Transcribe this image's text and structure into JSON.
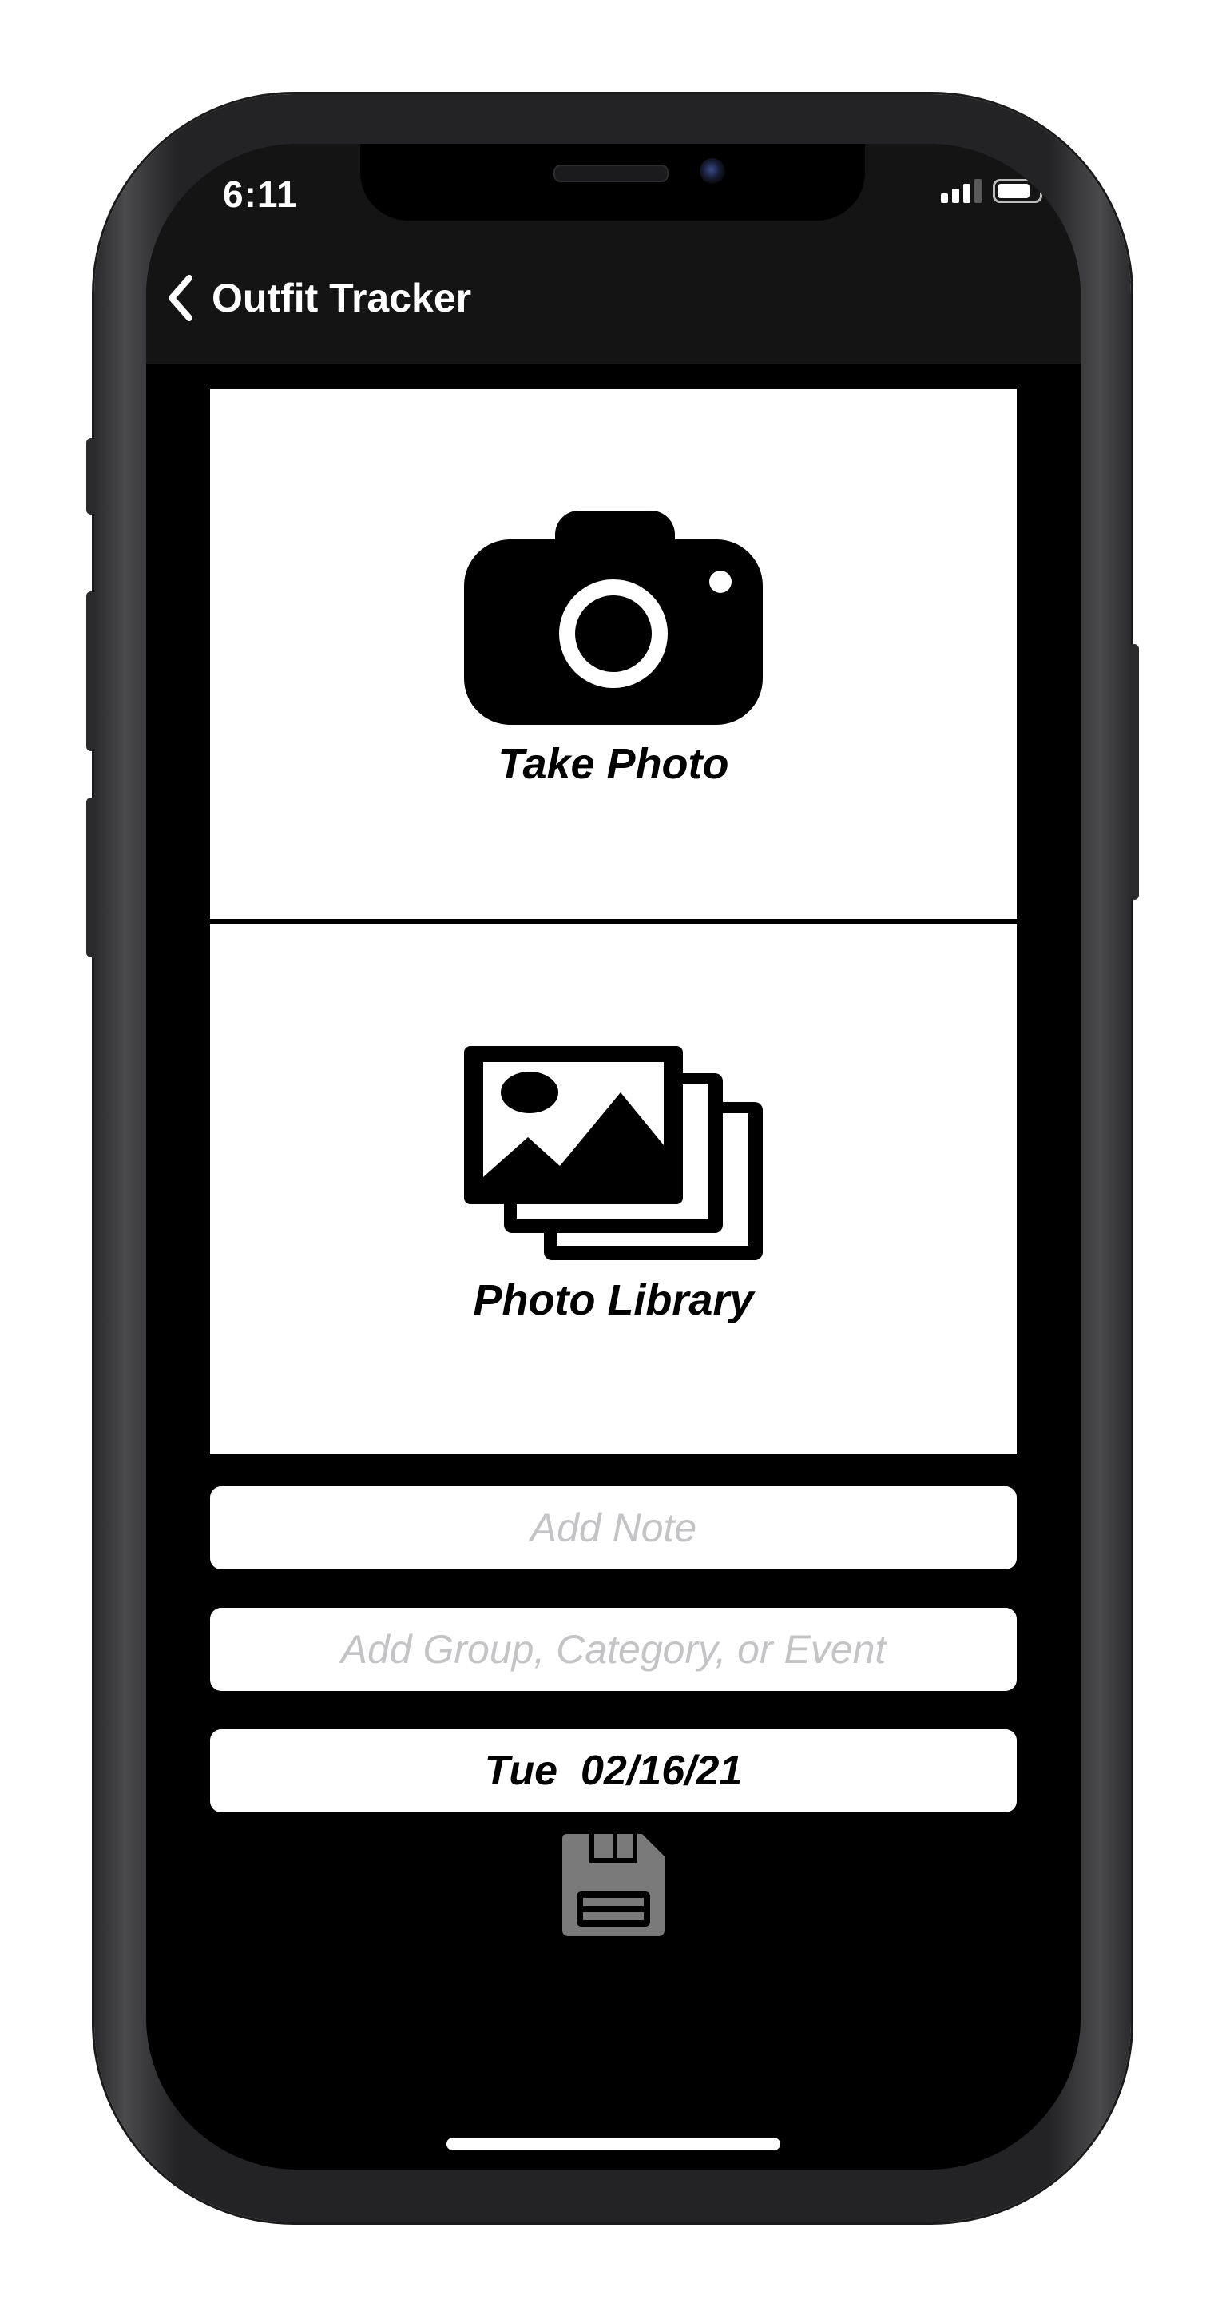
{
  "status_bar": {
    "time": "6:11",
    "signal_bars": 3,
    "signal_icon": "cellular-signal-icon",
    "battery_icon": "battery-icon",
    "battery_level": 0.75
  },
  "nav": {
    "back_icon": "chevron-left-icon",
    "title": "Outfit Tracker"
  },
  "actions": {
    "take_photo": {
      "label": "Take Photo",
      "icon": "camera-icon"
    },
    "photo_library": {
      "label": "Photo Library",
      "icon": "photo-stack-icon"
    }
  },
  "form": {
    "note": {
      "value": "",
      "placeholder": "Add Note"
    },
    "group": {
      "value": "",
      "placeholder": "Add Group, Category, or Event"
    },
    "date": "Tue  02/16/21"
  },
  "save": {
    "icon": "floppy-disk-icon"
  },
  "colors": {
    "background": "#000000",
    "nav_bar": "#141414",
    "panel": "#ffffff",
    "placeholder": "#c4c4c7",
    "save_icon": "#7a7a7a"
  }
}
